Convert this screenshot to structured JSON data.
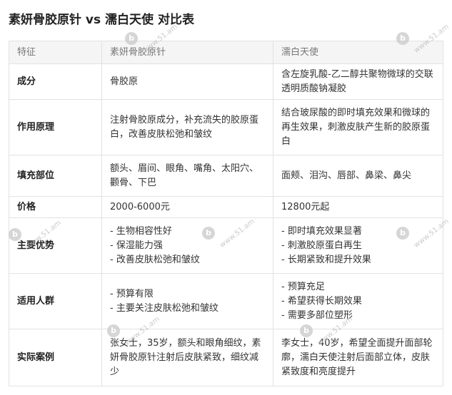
{
  "page_title": "素妍骨胶原针 vs 濡白天使 对比表",
  "table": {
    "headers": [
      "特征",
      "素妍骨胶原针",
      "濡白天使"
    ],
    "rows": [
      {
        "feature": "成分",
        "a": "骨胶原",
        "b": "含左旋乳酸-乙二醇共聚物微球的交联透明质酸钠凝胶"
      },
      {
        "feature": "作用原理",
        "a": "注射骨胶原成分，补充流失的胶原蛋白，改善皮肤松弛和皱纹",
        "b": "结合玻尿酸的即时填充效果和微球的再生效果，刺激皮肤产生新的胶原蛋白"
      },
      {
        "feature": "填充部位",
        "a": "额头、眉间、眼角、嘴角、太阳穴、颧骨、下巴",
        "b": "面颊、泪沟、唇部、鼻梁、鼻尖"
      },
      {
        "feature": "价格",
        "a": "2000-6000元",
        "b": "12800元起"
      },
      {
        "feature": "主要优势",
        "a_list": [
          "生物相容性好",
          "保湿能力强",
          "改善皮肤松弛和皱纹"
        ],
        "b_list": [
          "即时填充效果显著",
          "刺激胶原蛋白再生",
          "长期紧致和提升效果"
        ]
      },
      {
        "feature": "适用人群",
        "a_list": [
          "预算有限",
          "主要关注皮肤松弛和皱纹"
        ],
        "b_list": [
          "预算充足",
          "希望获得长期效果",
          "需要多部位塑形"
        ]
      },
      {
        "feature": "实际案例",
        "a": "张女士，35岁，额头和眼角细纹，素妍骨胶原针注射后皮肤紧致，细纹减少",
        "b": "李女士，40岁，希望全面提升面部轮廓，濡白天使注射后面部立体，皮肤紧致度和亮度提升"
      }
    ]
  },
  "watermark": {
    "logo": "b",
    "text": "www.51.am",
    "icon": "51am-logo-icon"
  }
}
